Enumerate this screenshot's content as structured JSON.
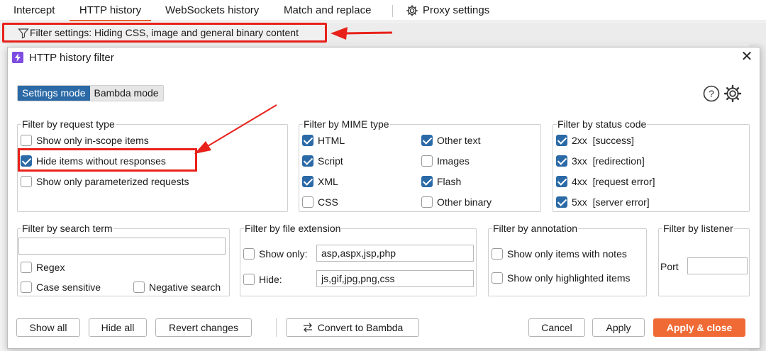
{
  "tabs": [
    {
      "label": "Intercept"
    },
    {
      "label": "HTTP history"
    },
    {
      "label": "WebSockets history"
    },
    {
      "label": "Match and replace"
    },
    {
      "label": "Proxy settings"
    }
  ],
  "filter_bar": {
    "text": "Filter settings: Hiding CSS, image and general binary content"
  },
  "dialog": {
    "title": "HTTP history filter",
    "modes": {
      "settings": "Settings mode",
      "bambda": "Bambda mode",
      "active": "settings"
    },
    "request_type": {
      "title": "Filter by request type",
      "items": [
        {
          "label": "Show only in-scope items",
          "checked": false
        },
        {
          "label": "Hide items without responses",
          "checked": true
        },
        {
          "label": "Show only parameterized requests",
          "checked": false
        }
      ]
    },
    "mime_type": {
      "title": "Filter by MIME type",
      "items": [
        {
          "label": "HTML",
          "checked": true
        },
        {
          "label": "Script",
          "checked": true
        },
        {
          "label": "XML",
          "checked": true
        },
        {
          "label": "CSS",
          "checked": false
        },
        {
          "label": "Other text",
          "checked": true
        },
        {
          "label": "Images",
          "checked": false
        },
        {
          "label": "Flash",
          "checked": true
        },
        {
          "label": "Other binary",
          "checked": false
        }
      ]
    },
    "status_code": {
      "title": "Filter by status code",
      "items": [
        {
          "label": "2xx  [success]",
          "checked": true
        },
        {
          "label": "3xx  [redirection]",
          "checked": true
        },
        {
          "label": "4xx  [request error]",
          "checked": true
        },
        {
          "label": "5xx  [server error]",
          "checked": true
        }
      ]
    },
    "search_term": {
      "title": "Filter by search term",
      "value": "",
      "regex": {
        "label": "Regex",
        "checked": false
      },
      "case_sensitive": {
        "label": "Case sensitive",
        "checked": false
      },
      "negative": {
        "label": "Negative search",
        "checked": false
      }
    },
    "file_extension": {
      "title": "Filter by file extension",
      "show_only": {
        "label": "Show only:",
        "checked": false,
        "value": "asp,aspx,jsp,php"
      },
      "hide": {
        "label": "Hide:",
        "checked": false,
        "value": "js,gif,jpg,png,css"
      }
    },
    "annotation": {
      "title": "Filter by annotation",
      "notes": {
        "label": "Show only items with notes",
        "checked": false
      },
      "highlighted": {
        "label": "Show only highlighted items",
        "checked": false
      }
    },
    "listener": {
      "title": "Filter by listener",
      "port_label": "Port",
      "port_value": ""
    },
    "buttons": {
      "show_all": "Show all",
      "hide_all": "Hide all",
      "revert": "Revert changes",
      "convert": "Convert to Bambda",
      "cancel": "Cancel",
      "apply": "Apply",
      "apply_close": "Apply & close"
    }
  },
  "colors": {
    "accent": "#f06a35",
    "selected": "#2b6aa6",
    "annotation_red": "#e8211a"
  }
}
